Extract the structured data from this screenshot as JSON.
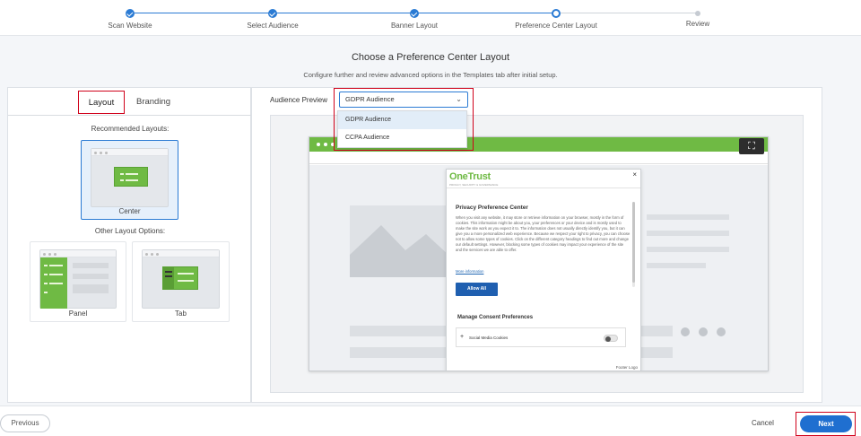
{
  "stepper": {
    "steps": [
      {
        "label": "Scan Website",
        "state": "done"
      },
      {
        "label": "Select Audience",
        "state": "done"
      },
      {
        "label": "Banner Layout",
        "state": "done"
      },
      {
        "label": "Preference Center Layout",
        "state": "current"
      },
      {
        "label": "Review",
        "state": "todo"
      }
    ]
  },
  "page": {
    "title": "Choose a Preference Center Layout",
    "subtitle": "Configure further and review advanced options in the Templates tab after initial setup."
  },
  "left_panel": {
    "tabs": [
      {
        "label": "Layout"
      },
      {
        "label": "Branding"
      }
    ],
    "recommended_title": "Recommended Layouts:",
    "recommended": [
      {
        "label": "Center"
      }
    ],
    "other_title": "Other Layout Options:",
    "other": [
      {
        "label": "Panel"
      },
      {
        "label": "Tab"
      }
    ]
  },
  "right_panel": {
    "audience_label": "Audience Preview",
    "audience_select": {
      "value": "GDPR Audience",
      "options": [
        "GDPR Audience",
        "CCPA Audience"
      ]
    }
  },
  "preview": {
    "brand": "OneTrust",
    "brand_tagline": "PRIVACY, SECURITY & GOVERNANCE",
    "modal_close": "×",
    "center_title": "Privacy Preference Center",
    "center_text": "When you visit any website, it may store or retrieve information on your browser, mostly in the form of cookies. This information might be about you, your preferences or your device and is mostly used to make the site work as you expect it to. The information does not usually directly identify you, but it can give you a more personalized web experience. Because we respect your right to privacy, you can choose not to allow some types of cookies. Click on the different category headings to find out more and change our default settings. However, blocking some types of cookies may impact your experience of the site and the services we are able to offer.",
    "more_info": "More information",
    "allow_all": "Allow All",
    "manage_title": "Manage Consent Preferences",
    "cookie_category": "Social Media Cookies",
    "footer_logo_alt": "Footer Logo"
  },
  "footer": {
    "previous": "Previous",
    "cancel": "Cancel",
    "next": "Next"
  },
  "colors": {
    "primary": "#2b7bd4",
    "next_button": "#1f6fd0",
    "highlight": "#d0021b",
    "brand_green": "#6fba44"
  }
}
